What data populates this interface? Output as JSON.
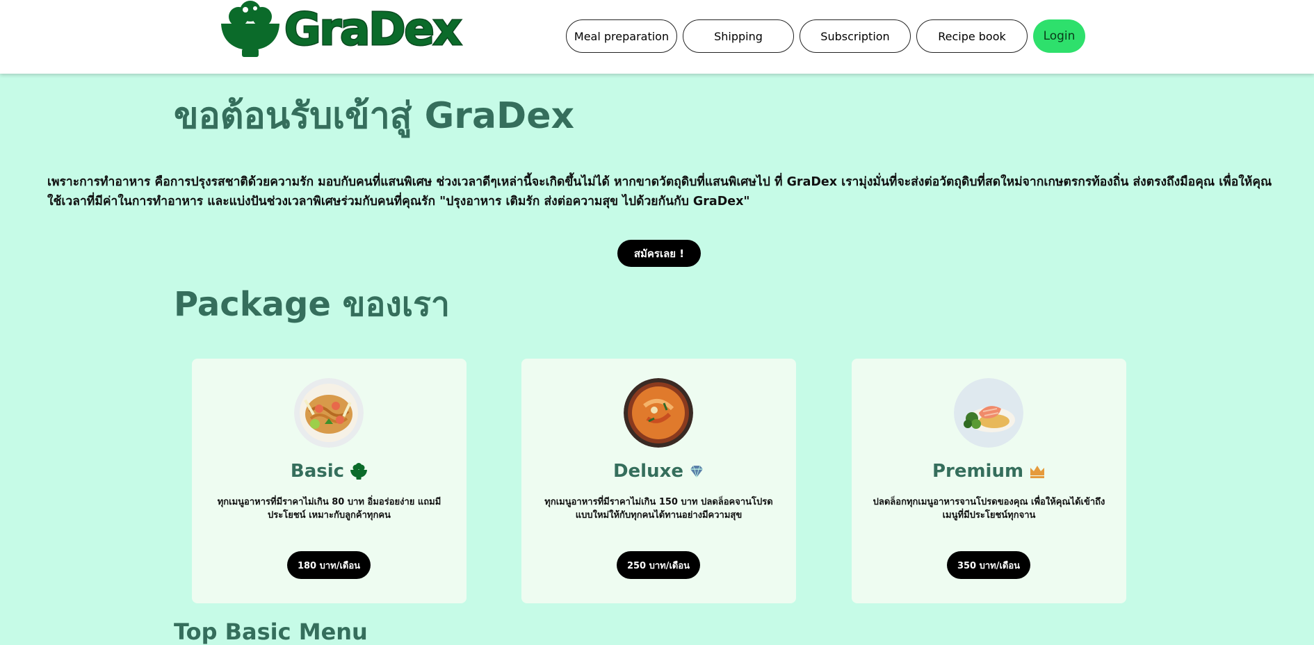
{
  "header": {
    "logo_text": "GraDex",
    "nav": [
      {
        "label": "Meal preparation"
      },
      {
        "label": "Shipping"
      },
      {
        "label": "Subscription"
      },
      {
        "label": "Recipe book"
      }
    ],
    "login_label": "Login"
  },
  "hero": {
    "title": "ขอต้อนรับเข้าสู่ GraDex",
    "intro": "เพราะการทำอาหาร คือการปรุงรสชาติด้วยความรัก มอบกับคนที่แสนพิเศษ ช่วงเวลาดีๆเหล่านี้จะเกิดขึ้นไม่ได้ หากขาดวัตถุดิบที่แสนพิเศษไป ที่ GraDex เรามุ่งมั่นที่จะส่งต่อวัตถุดิบที่สดใหม่จากเกษตรกรท้องถิ่น ส่งตรงถึงมือคุณ เพื่อให้คุณใช้เวลาที่มีค่าในการทำอาหาร และแบ่งปันช่วงเวลาพิเศษร่วมกับคนที่คุณรัก \"ปรุงอาหาร เติมรัก ส่งต่อความสุข ไปด้วยกันกับ GraDex\"",
    "signup_label": "สมัครเลย !"
  },
  "packages": {
    "title": "Package ของเรา",
    "items": [
      {
        "name": "Basic",
        "icon": "rice-bowl-icon",
        "desc": "ทุกเมนูอาหารที่มีราคาไม่เกิน 80 บาท อิ่มอร่อยง่าย แถมมีประโยชน์ เหมาะกับลูกค้าทุกคน",
        "price": "180 บาท/เดือน"
      },
      {
        "name": "Deluxe",
        "icon": "diamond-icon",
        "desc": "ทุกเมนูอาหารที่มีราคาไม่เกิน 150 บาท ปลดล็อคจานโปรดแบบใหม่ให้กับทุกคนได้ทานอย่างมีความสุข",
        "price": "250 บาท/เดือน"
      },
      {
        "name": "Premium",
        "icon": "crown-icon",
        "desc": "ปลดล็อกทุกเมนูอาหารจานโปรดของคุณ เพื่อให้คุณได้เข้าถึงเมนูที่มีประโยชน์ทุกจาน",
        "price": "350 บาท/เดือน"
      }
    ]
  },
  "top_menu": {
    "title": "Top Basic Menu"
  },
  "colors": {
    "background": "#c6fbe7",
    "heading": "#356e5c",
    "brand": "#0b6b2a",
    "login": "#2ee06c",
    "card": "#eefcf1"
  }
}
